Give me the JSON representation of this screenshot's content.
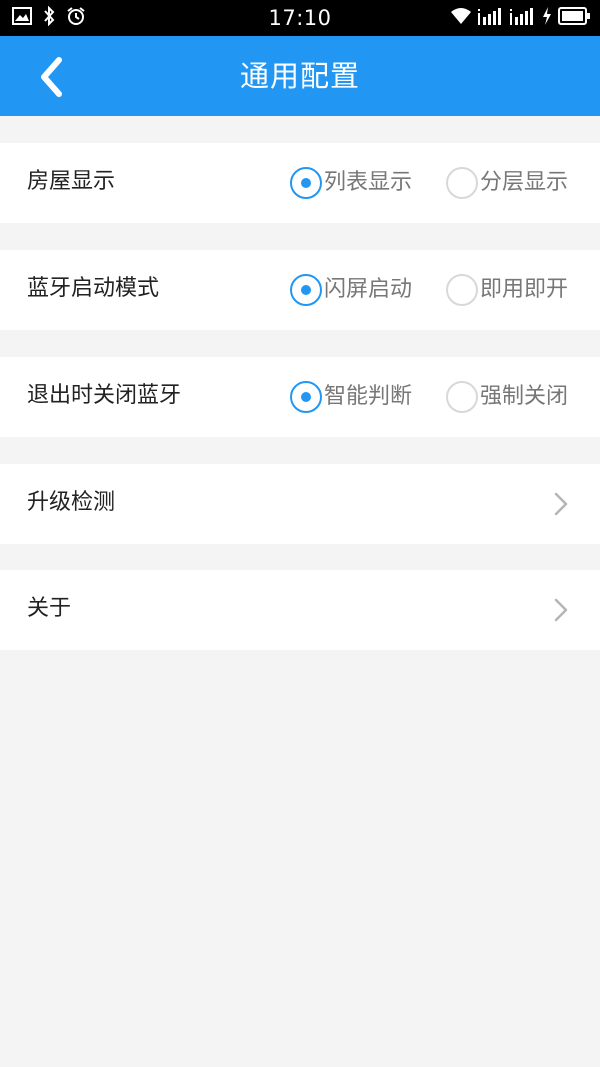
{
  "status_bar": {
    "time": "17:10",
    "left_icons": [
      "image-icon",
      "bluetooth-icon",
      "alarm-icon"
    ],
    "right_icons": [
      "wifi-icon",
      "signal-icon",
      "signal-icon",
      "charging-icon",
      "battery-icon"
    ]
  },
  "header": {
    "title": "通用配置",
    "back_icon": "chevron-left-icon",
    "background": "#2196f3"
  },
  "settings": {
    "house_display": {
      "label": "房屋显示",
      "options": [
        "列表显示",
        "分层显示"
      ],
      "selected": "列表显示"
    },
    "bluetooth_mode": {
      "label": "蓝牙启动模式",
      "options": [
        "闪屏启动",
        "即用即开"
      ],
      "selected": "闪屏启动"
    },
    "exit_bluetooth": {
      "label": "退出时关闭蓝牙",
      "options": [
        "智能判断",
        "强制关闭"
      ],
      "selected": "智能判断"
    },
    "upgrade_check": {
      "label": "升级检测"
    },
    "about": {
      "label": "关于"
    }
  },
  "colors": {
    "accent": "#2196f3",
    "page_background": "#f4f4f4",
    "row_background": "#ffffff"
  }
}
